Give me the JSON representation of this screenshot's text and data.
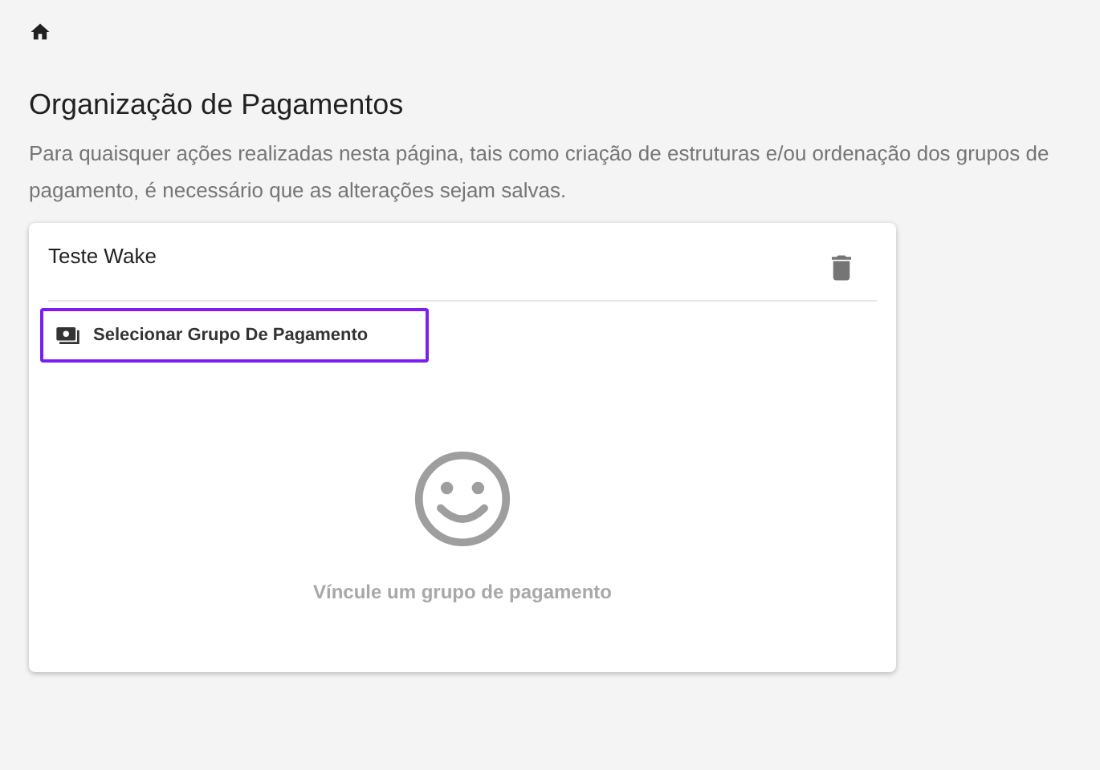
{
  "page": {
    "title": "Organização de Pagamentos",
    "description": "Para quaisquer ações realizadas nesta página, tais como criação de estruturas e/ou ordenação dos grupos de pagamento, é necessário que as alterações sejam salvas."
  },
  "card": {
    "name": "Teste Wake",
    "select_button": {
      "label": "Selecionar Grupo De Pagamento",
      "focused": true
    },
    "empty_message": "Víncule um grupo de pagamento"
  }
}
